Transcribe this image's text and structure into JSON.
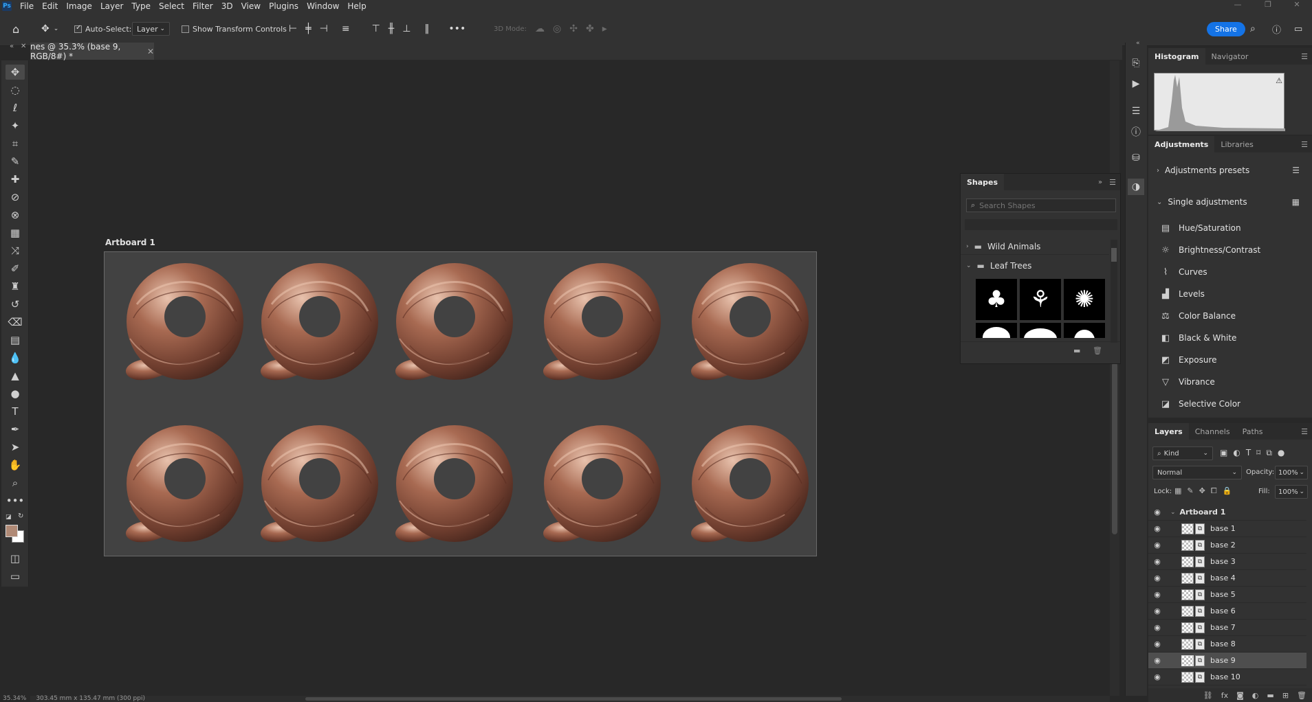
{
  "menubar": {
    "logo": "Ps",
    "items": [
      "File",
      "Edit",
      "Image",
      "Layer",
      "Type",
      "Select",
      "Filter",
      "3D",
      "View",
      "Plugins",
      "Window",
      "Help"
    ]
  },
  "options": {
    "auto_select_label": "Auto-Select:",
    "auto_select_checked": true,
    "layer_dropdown": "Layer",
    "show_transform_label": "Show Transform Controls",
    "mode_3d": "3D Mode:",
    "share": "Share"
  },
  "document": {
    "tab_title": "nes @ 35.3% (base 9, RGB/8#) *"
  },
  "artboard": {
    "label": "Artboard 1",
    "ring_fill": "#8a5440"
  },
  "status": {
    "zoom": "35.34%",
    "doc_size": "303.45 mm x 135.47 mm (300 ppi)"
  },
  "histogram": {
    "tabs": [
      "Histogram",
      "Navigator"
    ]
  },
  "adjustments": {
    "tabs": [
      "Adjustments",
      "Libraries"
    ],
    "presets_label": "Adjustments presets",
    "single_label": "Single adjustments",
    "items": [
      {
        "label": "Hue/Saturation",
        "icon": "hue-saturation-icon"
      },
      {
        "label": "Brightness/Contrast",
        "icon": "brightness-icon"
      },
      {
        "label": "Curves",
        "icon": "curves-icon"
      },
      {
        "label": "Levels",
        "icon": "levels-icon"
      },
      {
        "label": "Color Balance",
        "icon": "color-balance-icon"
      },
      {
        "label": "Black & White",
        "icon": "black-white-icon"
      },
      {
        "label": "Exposure",
        "icon": "exposure-icon"
      },
      {
        "label": "Vibrance",
        "icon": "vibrance-icon"
      },
      {
        "label": "Selective Color",
        "icon": "selective-color-icon"
      }
    ]
  },
  "shapes": {
    "title": "Shapes",
    "search_placeholder": "Search Shapes",
    "groups": [
      {
        "label": "Wild Animals",
        "expanded": false
      },
      {
        "label": "Leaf Trees",
        "expanded": true
      }
    ]
  },
  "layers": {
    "tabs": [
      "Layers",
      "Channels",
      "Paths"
    ],
    "filter_kind": "Kind",
    "blend_mode": "Normal",
    "opacity_label": "Opacity:",
    "opacity_value": "100%",
    "lock_label": "Lock:",
    "fill_label": "Fill:",
    "fill_value": "100%",
    "group_name": "Artboard 1",
    "items": [
      "base 1",
      "base 2",
      "base 3",
      "base 4",
      "base 5",
      "base 6",
      "base 7",
      "base 8",
      "base 9",
      "base 10"
    ],
    "selected": "base 9"
  }
}
